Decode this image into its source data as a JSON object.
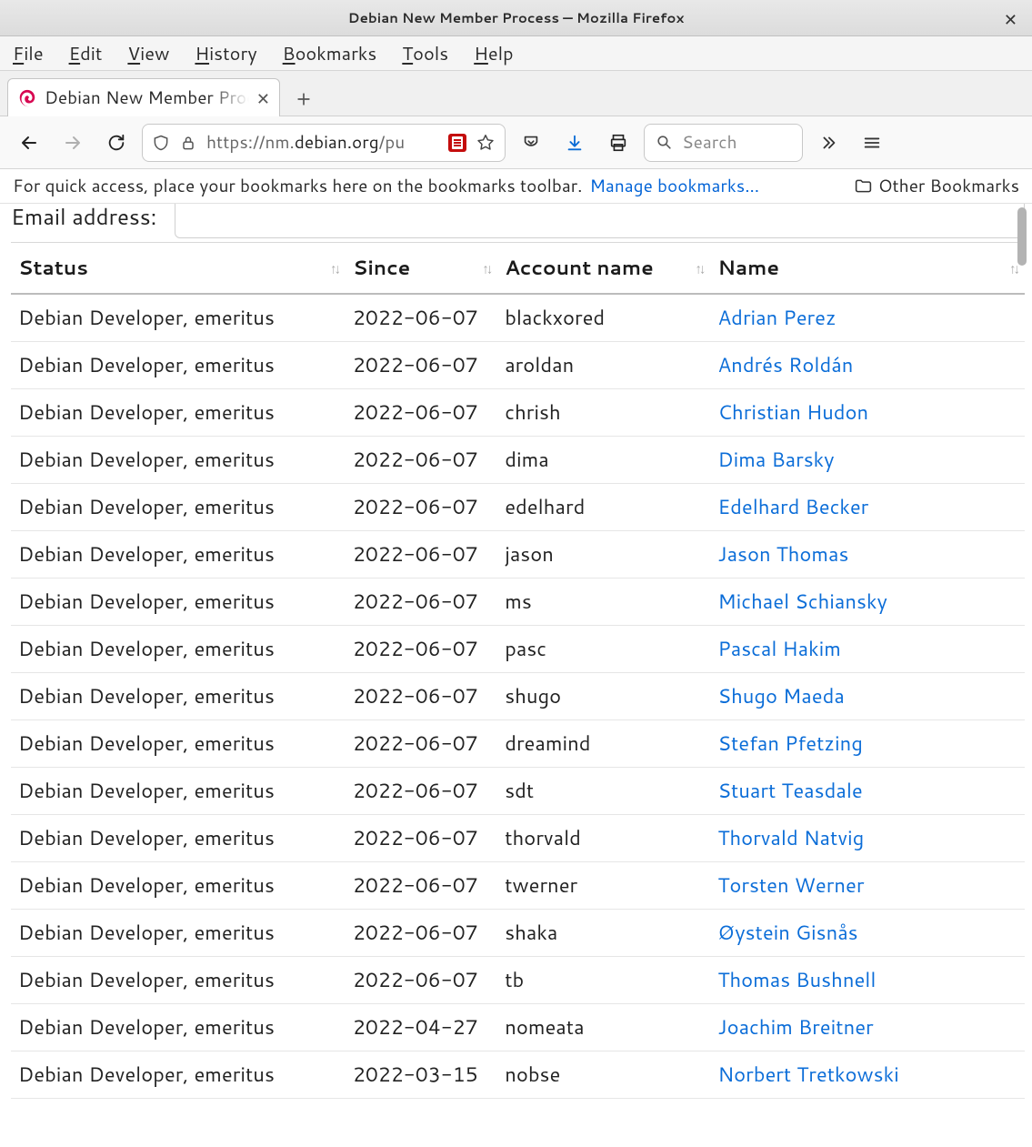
{
  "window": {
    "title": "Debian New Member Process — Mozilla Firefox"
  },
  "menubar": {
    "file": "File",
    "edit": "Edit",
    "view": "View",
    "history": "History",
    "bookmarks": "Bookmarks",
    "tools": "Tools",
    "help": "Help"
  },
  "tab": {
    "title": "Debian New Member Process"
  },
  "url": {
    "scheme": "https://",
    "sub": "nm.",
    "domain": "debian.org",
    "path": "/pu"
  },
  "searchbar": {
    "placeholder": "Search"
  },
  "bookmarksbar": {
    "hint": "For quick access, place your bookmarks here on the bookmarks toolbar.",
    "manage": "Manage bookmarks...",
    "other": "Other Bookmarks"
  },
  "page": {
    "email_label": "Email address:",
    "columns": {
      "status": "Status",
      "since": "Since",
      "account": "Account name",
      "name": "Name"
    },
    "rows": [
      {
        "status": "Debian Developer, emeritus",
        "since": "2022-06-07",
        "account": "blackxored",
        "name": "Adrian Perez"
      },
      {
        "status": "Debian Developer, emeritus",
        "since": "2022-06-07",
        "account": "aroldan",
        "name": "Andrés Roldán"
      },
      {
        "status": "Debian Developer, emeritus",
        "since": "2022-06-07",
        "account": "chrish",
        "name": "Christian Hudon"
      },
      {
        "status": "Debian Developer, emeritus",
        "since": "2022-06-07",
        "account": "dima",
        "name": "Dima Barsky"
      },
      {
        "status": "Debian Developer, emeritus",
        "since": "2022-06-07",
        "account": "edelhard",
        "name": "Edelhard Becker"
      },
      {
        "status": "Debian Developer, emeritus",
        "since": "2022-06-07",
        "account": "jason",
        "name": "Jason Thomas"
      },
      {
        "status": "Debian Developer, emeritus",
        "since": "2022-06-07",
        "account": "ms",
        "name": "Michael Schiansky"
      },
      {
        "status": "Debian Developer, emeritus",
        "since": "2022-06-07",
        "account": "pasc",
        "name": "Pascal Hakim"
      },
      {
        "status": "Debian Developer, emeritus",
        "since": "2022-06-07",
        "account": "shugo",
        "name": "Shugo Maeda"
      },
      {
        "status": "Debian Developer, emeritus",
        "since": "2022-06-07",
        "account": "dreamind",
        "name": "Stefan Pfetzing"
      },
      {
        "status": "Debian Developer, emeritus",
        "since": "2022-06-07",
        "account": "sdt",
        "name": "Stuart Teasdale"
      },
      {
        "status": "Debian Developer, emeritus",
        "since": "2022-06-07",
        "account": "thorvald",
        "name": "Thorvald Natvig"
      },
      {
        "status": "Debian Developer, emeritus",
        "since": "2022-06-07",
        "account": "twerner",
        "name": "Torsten Werner"
      },
      {
        "status": "Debian Developer, emeritus",
        "since": "2022-06-07",
        "account": "shaka",
        "name": "Øystein Gisnås"
      },
      {
        "status": "Debian Developer, emeritus",
        "since": "2022-06-07",
        "account": "tb",
        "name": "Thomas Bushnell"
      },
      {
        "status": "Debian Developer, emeritus",
        "since": "2022-04-27",
        "account": "nomeata",
        "name": "Joachim Breitner"
      },
      {
        "status": "Debian Developer, emeritus",
        "since": "2022-03-15",
        "account": "nobse",
        "name": "Norbert Tretkowski"
      }
    ]
  }
}
